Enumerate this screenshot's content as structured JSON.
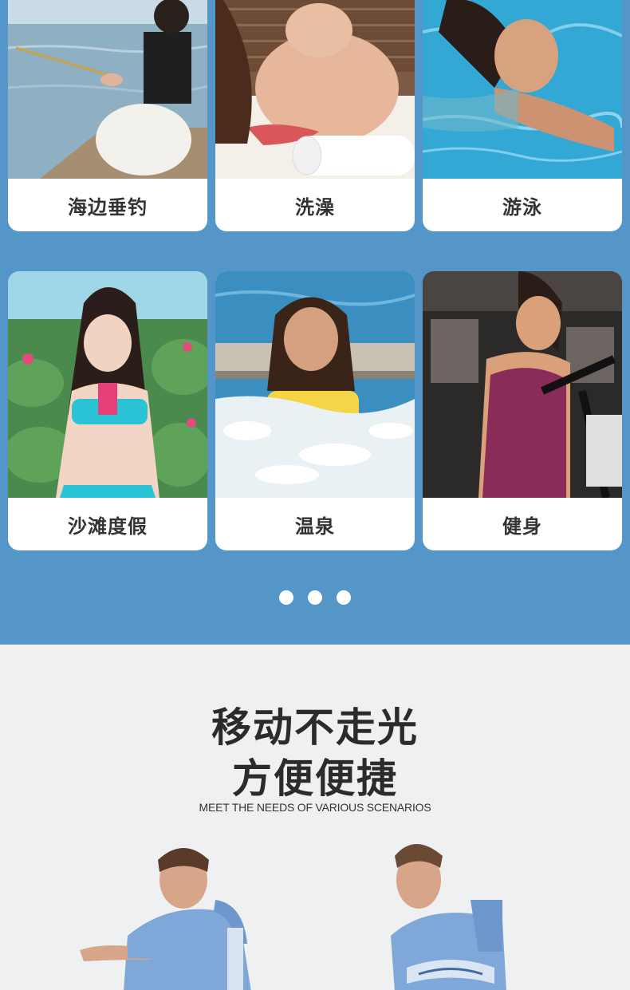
{
  "scenes": {
    "row1": [
      {
        "label": "海边垂钓",
        "image": "woman-fishing-by-sea"
      },
      {
        "label": "洗澡",
        "image": "woman-with-towel-spa"
      },
      {
        "label": "游泳",
        "image": "woman-swimming-pool"
      }
    ],
    "row2": [
      {
        "label": "沙滩度假",
        "image": "woman-bikini-beach"
      },
      {
        "label": "温泉",
        "image": "woman-hot-spring"
      },
      {
        "label": "健身",
        "image": "woman-gym-elliptical"
      }
    ]
  },
  "pagination": {
    "count": 3
  },
  "promo": {
    "title_line1": "移动不走光",
    "title_line2": "方便便捷",
    "subtitle": "MEET THE NEEDS OF VARIOUS SCENARIOS",
    "models": [
      "man-in-blue-hooded-poncho-left",
      "man-in-blue-hooded-poncho-right"
    ]
  },
  "colors": {
    "section_blue": "#5596c8",
    "card_bg": "#ffffff",
    "label_text": "#333333",
    "page_bg": "#eef0f2",
    "poncho_blue": "#7fa7d8"
  }
}
